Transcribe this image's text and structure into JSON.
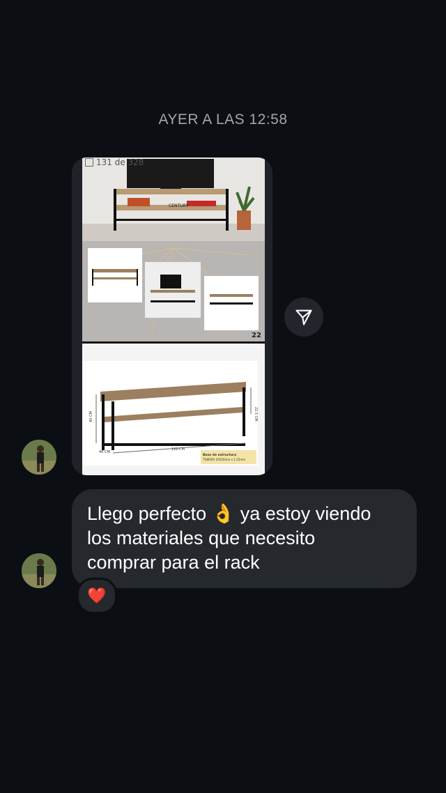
{
  "conversation": {
    "timestamp": "AYER A LAS 12:58"
  },
  "shared_post": {
    "page_counter": "131 de 328",
    "page_number": "22",
    "brand_label": "CENTURY",
    "dimension_width": "120 CM",
    "dimension_depth": "40 CM",
    "dimension_height": "40 CM",
    "dimension_shelf": "22.5 CM",
    "spec_title": "Base de estructura",
    "spec_text": "TUBERÍA 20X20mm e 1.25mm"
  },
  "message": {
    "text": "Llego perfecto 👌 ya estoy viendo\nlos materiales que necesito\ncomprar para el rack",
    "reaction": "❤️"
  },
  "colors": {
    "background": "#0b0f14",
    "bubble": "#25282d",
    "timestamp": "#a3a7ad"
  }
}
